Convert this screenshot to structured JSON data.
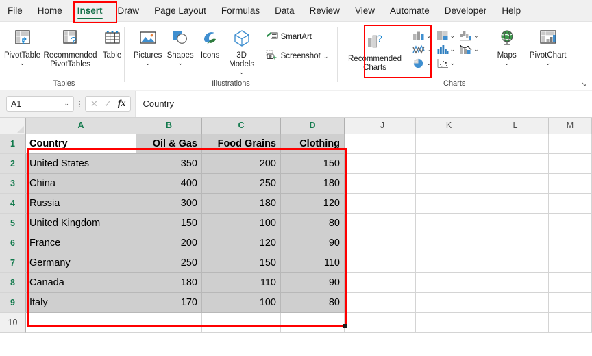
{
  "app": {
    "name": "Microsoft Excel"
  },
  "tabs": [
    {
      "label": "File",
      "active": false
    },
    {
      "label": "Home",
      "active": false
    },
    {
      "label": "Insert",
      "active": true
    },
    {
      "label": "Draw",
      "active": false
    },
    {
      "label": "Page Layout",
      "active": false
    },
    {
      "label": "Formulas",
      "active": false
    },
    {
      "label": "Data",
      "active": false
    },
    {
      "label": "Review",
      "active": false
    },
    {
      "label": "View",
      "active": false
    },
    {
      "label": "Automate",
      "active": false
    },
    {
      "label": "Developer",
      "active": false
    },
    {
      "label": "Help",
      "active": false
    }
  ],
  "ribbon": {
    "groups": [
      {
        "name": "Tables",
        "label": "Tables",
        "buttons": [
          {
            "label": "PivotTable",
            "icon": "pivot-table-icon",
            "caret": "⌄"
          },
          {
            "label": "Recommended PivotTables",
            "icon": "recommended-pivot-tables-icon",
            "caret": ""
          },
          {
            "label": "Table",
            "icon": "table-icon",
            "caret": ""
          }
        ]
      },
      {
        "name": "Illustrations",
        "label": "Illustrations",
        "buttons": [
          {
            "label": "Pictures",
            "icon": "pictures-icon",
            "caret": "⌄"
          },
          {
            "label": "Shapes",
            "icon": "shapes-icon",
            "caret": "⌄"
          },
          {
            "label": "Icons",
            "icon": "icons-icon",
            "caret": ""
          },
          {
            "label": "3D Models",
            "icon": "3d-models-icon",
            "caret": "⌄"
          }
        ],
        "small_buttons": [
          {
            "label": "SmartArt",
            "icon": "smartart-icon",
            "caret": ""
          },
          {
            "label": "Screenshot",
            "icon": "screenshot-icon",
            "caret": "⌄"
          }
        ]
      },
      {
        "name": "Charts",
        "label": "Charts",
        "recommended": {
          "label": "Recommended Charts",
          "icon": "recommended-charts-icon",
          "highlighted": true
        },
        "chart_types": [
          {
            "name": "column-bar-chart-icon",
            "caret": "⌄"
          },
          {
            "name": "hierarchy-chart-icon",
            "caret": "⌄"
          },
          {
            "name": "waterfall-chart-icon",
            "caret": "⌄"
          },
          {
            "name": "line-chart-icon",
            "caret": "⌄"
          },
          {
            "name": "statistic-chart-icon",
            "caret": "⌄"
          },
          {
            "name": "combo-chart-icon",
            "caret": "⌄"
          },
          {
            "name": "pie-chart-icon",
            "caret": "⌄"
          },
          {
            "name": "scatter-chart-icon",
            "caret": "⌄"
          }
        ],
        "buttons": [
          {
            "label": "Maps",
            "icon": "maps-icon",
            "caret": "⌄"
          },
          {
            "label": "PivotChart",
            "icon": "pivot-chart-icon",
            "caret": "⌄"
          }
        ],
        "launcher": "dialog-launcher-icon"
      }
    ]
  },
  "formula_bar": {
    "name_box_value": "A1",
    "name_box_caret": "⌄",
    "cancel_icon": "✕",
    "enter_icon": "✓",
    "function_icon": "fx",
    "formula_value": "Country"
  },
  "grid": {
    "columns": [
      {
        "label": "A",
        "width": 161,
        "selected": true
      },
      {
        "label": "B",
        "width": 96,
        "selected": true
      },
      {
        "label": "C",
        "width": 115,
        "selected": true
      },
      {
        "label": "D",
        "width": 93,
        "selected": true
      },
      {
        "label": "",
        "width": 7,
        "selected": false
      },
      {
        "label": "J",
        "width": 97,
        "selected": false
      },
      {
        "label": "K",
        "width": 97,
        "selected": false
      },
      {
        "label": "L",
        "width": 97,
        "selected": false
      },
      {
        "label": "M",
        "width": 63,
        "selected": false
      }
    ],
    "rows": [
      {
        "num": "1",
        "selected": true,
        "cells": [
          "Country",
          "Oil & Gas",
          "Food Grains",
          "Clothing"
        ],
        "header": true
      },
      {
        "num": "2",
        "selected": true,
        "cells": [
          "United States",
          "350",
          "200",
          "150"
        ],
        "header": false
      },
      {
        "num": "3",
        "selected": true,
        "cells": [
          "China",
          "400",
          "250",
          "180"
        ],
        "header": false
      },
      {
        "num": "4",
        "selected": true,
        "cells": [
          "Russia",
          "300",
          "180",
          "120"
        ],
        "header": false
      },
      {
        "num": "5",
        "selected": true,
        "cells": [
          "United Kingdom",
          "150",
          "100",
          "80"
        ],
        "header": false
      },
      {
        "num": "6",
        "selected": true,
        "cells": [
          "France",
          "200",
          "120",
          "90"
        ],
        "header": false
      },
      {
        "num": "7",
        "selected": true,
        "cells": [
          "Germany",
          "250",
          "150",
          "110"
        ],
        "header": false
      },
      {
        "num": "8",
        "selected": true,
        "cells": [
          "Canada",
          "180",
          "110",
          "90"
        ],
        "header": false
      },
      {
        "num": "9",
        "selected": true,
        "cells": [
          "Italy",
          "170",
          "100",
          "80"
        ],
        "header": false
      },
      {
        "num": "10",
        "selected": false,
        "cells": [
          "",
          "",
          "",
          ""
        ],
        "header": false
      }
    ],
    "selected_range": "A1:D9",
    "active_cell": "A1"
  },
  "table_data": {
    "type": "table",
    "headers": [
      "Country",
      "Oil & Gas",
      "Food Grains",
      "Clothing"
    ],
    "rows": [
      [
        "United States",
        350,
        200,
        150
      ],
      [
        "China",
        400,
        250,
        180
      ],
      [
        "Russia",
        300,
        180,
        120
      ],
      [
        "United Kingdom",
        150,
        100,
        80
      ],
      [
        "France",
        200,
        120,
        90
      ],
      [
        "Germany",
        250,
        150,
        110
      ],
      [
        "Canada",
        180,
        110,
        90
      ],
      [
        "Italy",
        170,
        100,
        80
      ]
    ]
  },
  "colors": {
    "accent_green": "#127244",
    "highlight_red": "#ff0000",
    "selection_gray": "#cfcfcf",
    "ribbon_bg": "#f0f0f0"
  }
}
